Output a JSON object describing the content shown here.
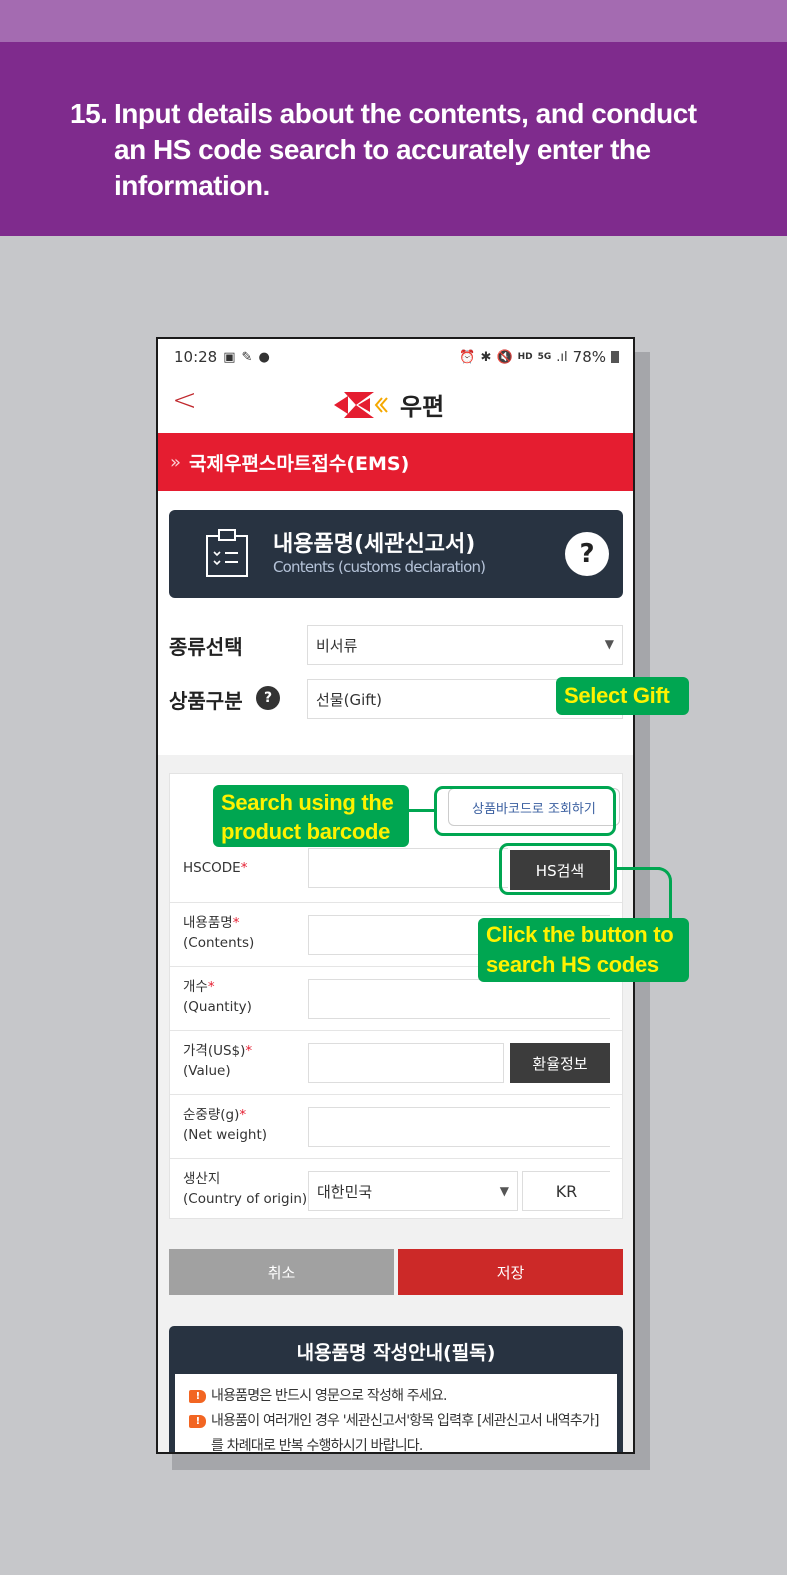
{
  "step": {
    "number": "15.",
    "text": "Input details about the contents, and conduct an HS code search to accurately enter the information."
  },
  "status_bar": {
    "time": "10:28",
    "left_icons": [
      "gallery-icon",
      "feather-icon",
      "chat-icon"
    ],
    "right_icons": [
      "alarm-icon",
      "bluetooth-icon",
      "mute-icon",
      "hd-voice-icon",
      "5g-icon",
      "signal-icon"
    ],
    "battery": "78%"
  },
  "app_header": {
    "logo_text": "우편",
    "back_label": "<"
  },
  "section_bar": {
    "chevron": "»",
    "title": "국제우편스마트접수(EMS)"
  },
  "section_card": {
    "title": "내용품명(세관신고서)",
    "subtitle": "Contents (customs declaration)",
    "help": "?"
  },
  "type_select": {
    "label": "종류선택",
    "value": "비서류"
  },
  "category_select": {
    "label": "상품구분",
    "help": "?",
    "value": "선물(Gift)"
  },
  "form": {
    "barcode_button": "상품바코드로 조회하기",
    "rows": [
      {
        "label": "HSCODE",
        "sub": "",
        "required": "*",
        "value": "",
        "button": "HS검색"
      },
      {
        "label": "내용품명",
        "sub": "(Contents)",
        "required": "*",
        "value": ""
      },
      {
        "label": "개수",
        "sub": "(Quantity)",
        "required": "*",
        "value": ""
      },
      {
        "label": "가격(US$)",
        "sub": "(Value)",
        "required": "*",
        "value": "",
        "button": "환율정보"
      },
      {
        "label": "순중량(g)",
        "sub": "(Net weight)",
        "required": "*",
        "value": ""
      },
      {
        "label": "생산지",
        "sub": "(Country of origin)",
        "required": "",
        "value": "대한민국",
        "code": "KR"
      }
    ]
  },
  "actions": {
    "cancel": "취소",
    "save": "저장"
  },
  "guide": {
    "title": "내용품명 작성안내(필독)",
    "items": [
      "내용품명은 반드시 영문으로 작성해 주세요.",
      "내용품이 여러개인 경우 '세관신고서'항목 입력후 [세관신고서 내역추가]를 차례대로 반복 수행하시기 바랍니다."
    ]
  },
  "annotations": {
    "select_gift": "Select Gift",
    "barcode": "Search using the product barcode",
    "hs_search": "Click the button to search HS codes"
  },
  "colors": {
    "header_purple": "#7f2b8d",
    "brand_red": "#e51d30",
    "callout_green": "#00a651",
    "callout_text": "#fff200",
    "card_navy": "#283341"
  }
}
